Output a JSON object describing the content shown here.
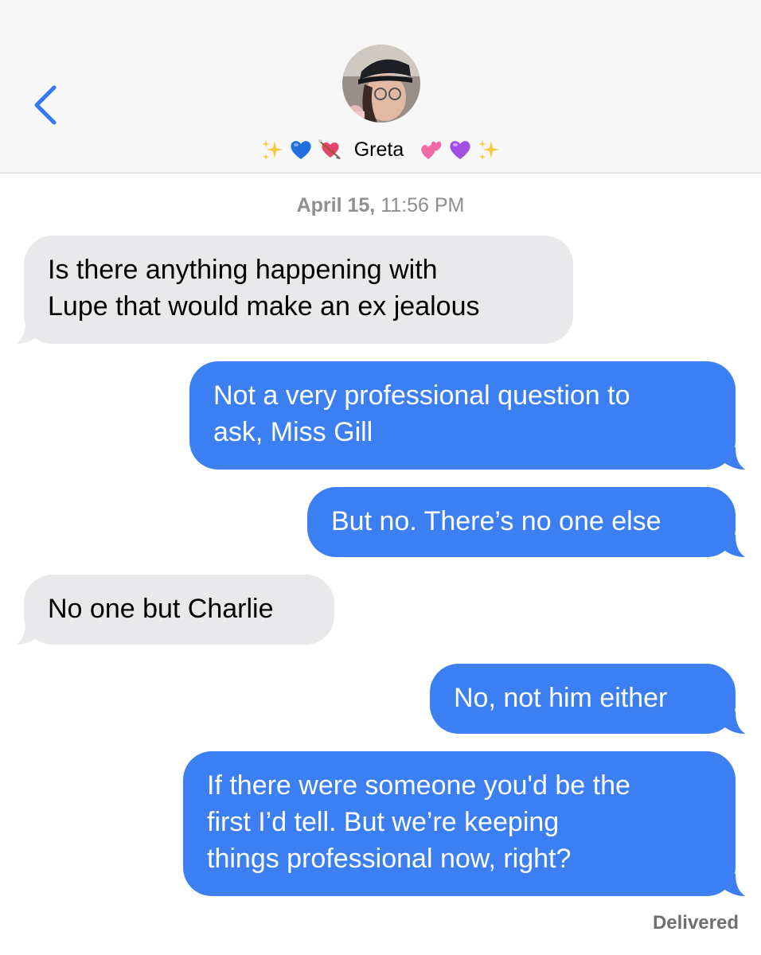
{
  "header": {
    "contact_name": "Greta",
    "left_emojis": [
      "sparkles",
      "blue-heart",
      "heart-with-arrow"
    ],
    "right_emojis": [
      "two-hearts",
      "purple-heart",
      "sparkles"
    ]
  },
  "timestamp": {
    "date": "April 15,",
    "time": " 11:56 PM"
  },
  "messages": [
    {
      "direction": "in",
      "lines": [
        "Is there anything happening with",
        "Lupe that would make an ex jealous"
      ]
    },
    {
      "direction": "out",
      "lines": [
        "Not a very professional question to",
        "ask, Miss Gill"
      ]
    },
    {
      "direction": "out",
      "lines": [
        "But no. There’s no one else"
      ]
    },
    {
      "direction": "in",
      "lines": [
        "No one but Charlie"
      ]
    },
    {
      "direction": "out",
      "lines": [
        "No, not him either"
      ]
    },
    {
      "direction": "out",
      "lines": [
        "If there were someone you'd be the",
        "first I’d tell. But we’re keeping",
        "things professional now, right?"
      ]
    }
  ],
  "status": "Delivered",
  "colors": {
    "outgoing": "#3b7ff2",
    "incoming": "#e9e9eb",
    "back_chevron": "#3478f6"
  }
}
